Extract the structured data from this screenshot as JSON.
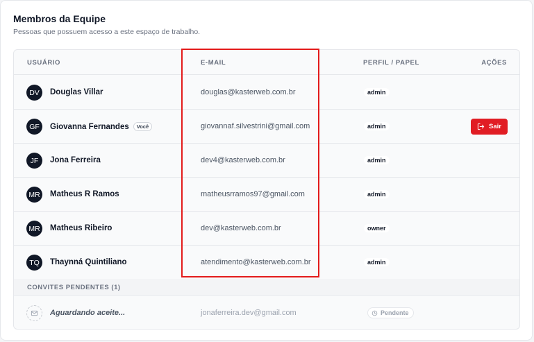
{
  "header": {
    "title": "Membros da Equipe",
    "subtitle": "Pessoas que possuem acesso a este espaço de trabalho."
  },
  "table": {
    "columns": {
      "user": "USUÁRIO",
      "email": "E-MAIL",
      "role": "PERFIL / PAPEL",
      "actions": "AÇÕES"
    }
  },
  "members": [
    {
      "initials": "DV",
      "name": "Douglas Villar",
      "email": "douglas@kasterweb.com.br",
      "role": "admin"
    },
    {
      "initials": "GF",
      "name": "Giovanna Fernandes",
      "badge": "Você",
      "email": "giovannaf.silvestrini@gmail.com",
      "role": "admin",
      "action": "Sair"
    },
    {
      "initials": "JF",
      "name": "Jona Ferreira",
      "email": "dev4@kasterweb.com.br",
      "role": "admin"
    },
    {
      "initials": "MR",
      "name": "Matheus R Ramos",
      "email": "matheusrramos97@gmail.com",
      "role": "admin"
    },
    {
      "initials": "MR",
      "name": "Matheus Ribeiro",
      "email": "dev@kasterweb.com.br",
      "role": "owner"
    },
    {
      "initials": "TQ",
      "name": "Thaynná Quintiliano",
      "email": "atendimento@kasterweb.com.br",
      "role": "admin"
    }
  ],
  "pending": {
    "title": "CONVITES PENDENTES (1)",
    "items": [
      {
        "name": "Aguardando aceite...",
        "email": "jonaferreira.dev@gmail.com",
        "status": "Pendente"
      }
    ]
  },
  "colors": {
    "accent_red": "#e11d24",
    "avatar_bg": "#111827",
    "highlight_border": "#e31b1b"
  },
  "icons": {
    "leave": "logout-icon",
    "pending_avatar": "mail-icon",
    "pending_status": "clock-icon"
  }
}
